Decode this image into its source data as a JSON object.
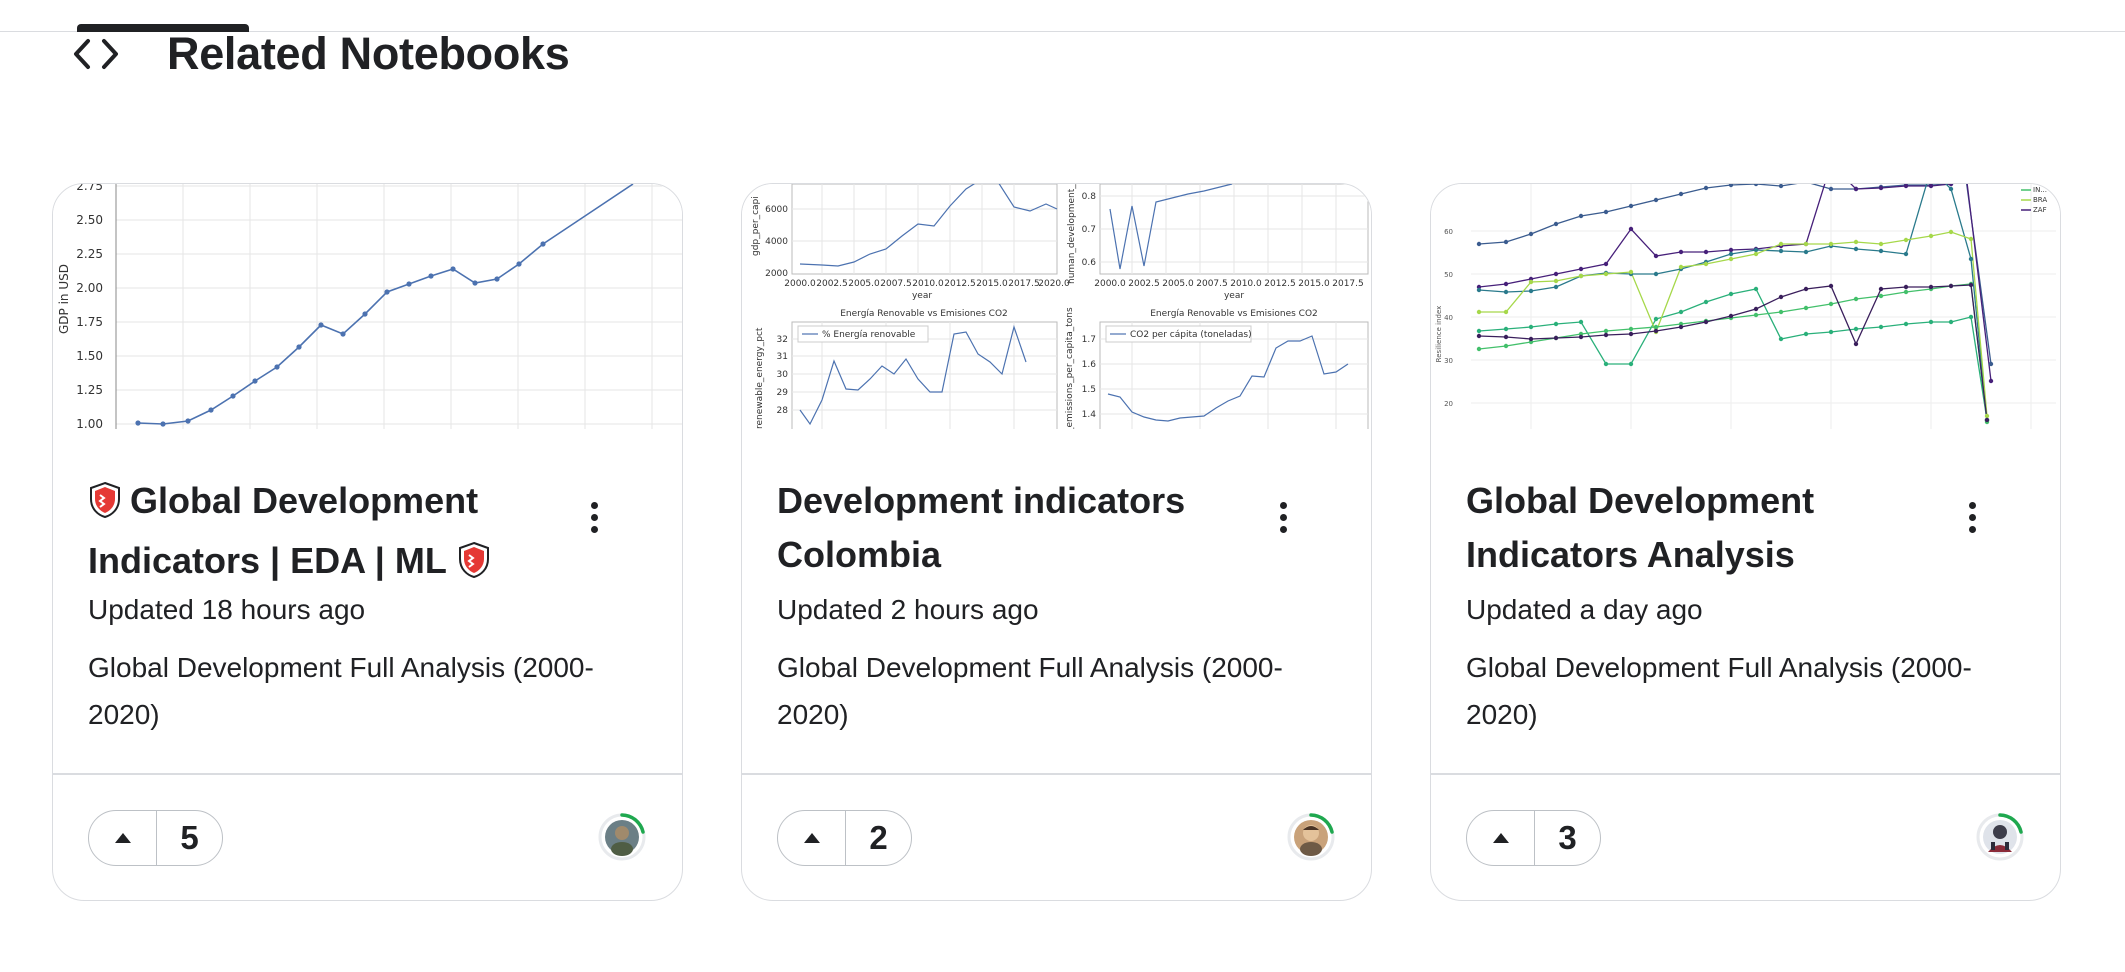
{
  "section": {
    "title": "Related Notebooks",
    "icon": "code-icon"
  },
  "cards": [
    {
      "title": "Global Development Indicators | EDA | ML",
      "title_icon": "red-shield-emoji",
      "updated": "Updated 18 hours ago",
      "description": "Global Development Full Analysis (2000-2020)",
      "votes": "5",
      "thumbnail": {
        "ylabel": "GDP in USD",
        "ytick_labels": [
          "2.75",
          "2.50",
          "2.25",
          "2.00",
          "1.75",
          "1.50",
          "1.25",
          "1.00"
        ]
      }
    },
    {
      "title": "Development indicators Colombia",
      "updated": "Updated 2 hours ago",
      "description": "Global Development Full Analysis (2000-2020)",
      "votes": "2",
      "thumbnail": {
        "top_left": {
          "ylabel": "gdp_per_capi",
          "yticks": [
            "6000",
            "4000",
            "2000"
          ],
          "xticks": [
            "2000.0",
            "2002.5",
            "2005.0",
            "2007.5",
            "2010.0",
            "2012.5",
            "2015.0",
            "2017.5",
            "2020.0"
          ],
          "xlabel": "year"
        },
        "top_right": {
          "ylabel": "human_development_",
          "yticks": [
            "0.8",
            "0.7",
            "0.6"
          ],
          "xticks": [
            "2000.0",
            "2002.5",
            "2005.0",
            "2007.5",
            "2010.0",
            "2012.5",
            "2015.0",
            "2017.5"
          ],
          "xlabel": "year"
        },
        "bottom_left": {
          "title": "Energía Renovable vs Emisiones CO2",
          "ylabel": "renewable_energy_pct",
          "legend": "% Energía renovable",
          "yticks": [
            "32",
            "31",
            "30",
            "29",
            "28"
          ]
        },
        "bottom_right": {
          "title": "Energía Renovable vs Emisiones CO2",
          "ylabel": "_emissions_per_capita_tons",
          "legend": "CO2 per cápita (toneladas)",
          "yticks": [
            "1.7",
            "1.6",
            "1.5",
            "1.4"
          ]
        }
      }
    },
    {
      "title": "Global Development Indicators Analysis",
      "updated": "Updated a day ago",
      "description": "Global Development Full Analysis (2000-2020)",
      "votes": "3",
      "thumbnail": {
        "ylabel": "Resilience index",
        "yticks": [
          "60",
          "50",
          "40",
          "30",
          "20"
        ],
        "legend": [
          "IN...",
          "BRA",
          "ZAF"
        ]
      }
    }
  ],
  "colors": {
    "chart_blue": "#4c72b0",
    "avatar_ring": "#20beff",
    "progress_ring": "#1fa84f"
  }
}
